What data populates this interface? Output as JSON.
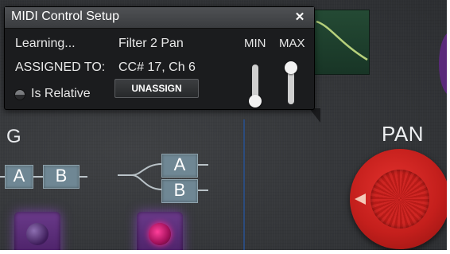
{
  "popup": {
    "title": "MIDI Control Setup",
    "close_icon": "close-icon",
    "learning_label": "Learning...",
    "parameter": "Filter 2 Pan",
    "assigned_label": "ASSIGNED TO:",
    "assigned_value": "CC# 17, Ch 6",
    "unassign_label": "UNASSIGN",
    "relative_label": "Is Relative",
    "min_label": "MIN",
    "max_label": "MAX",
    "min_value": 0.0,
    "max_value": 1.0
  },
  "background": {
    "g_label": "G",
    "blocks_left": [
      "A",
      "B"
    ],
    "blocks_right": [
      "A",
      "B"
    ],
    "pan_label": "PAN",
    "knob_color": "#d22a26",
    "pad_right_color": "#ff2a8d"
  }
}
